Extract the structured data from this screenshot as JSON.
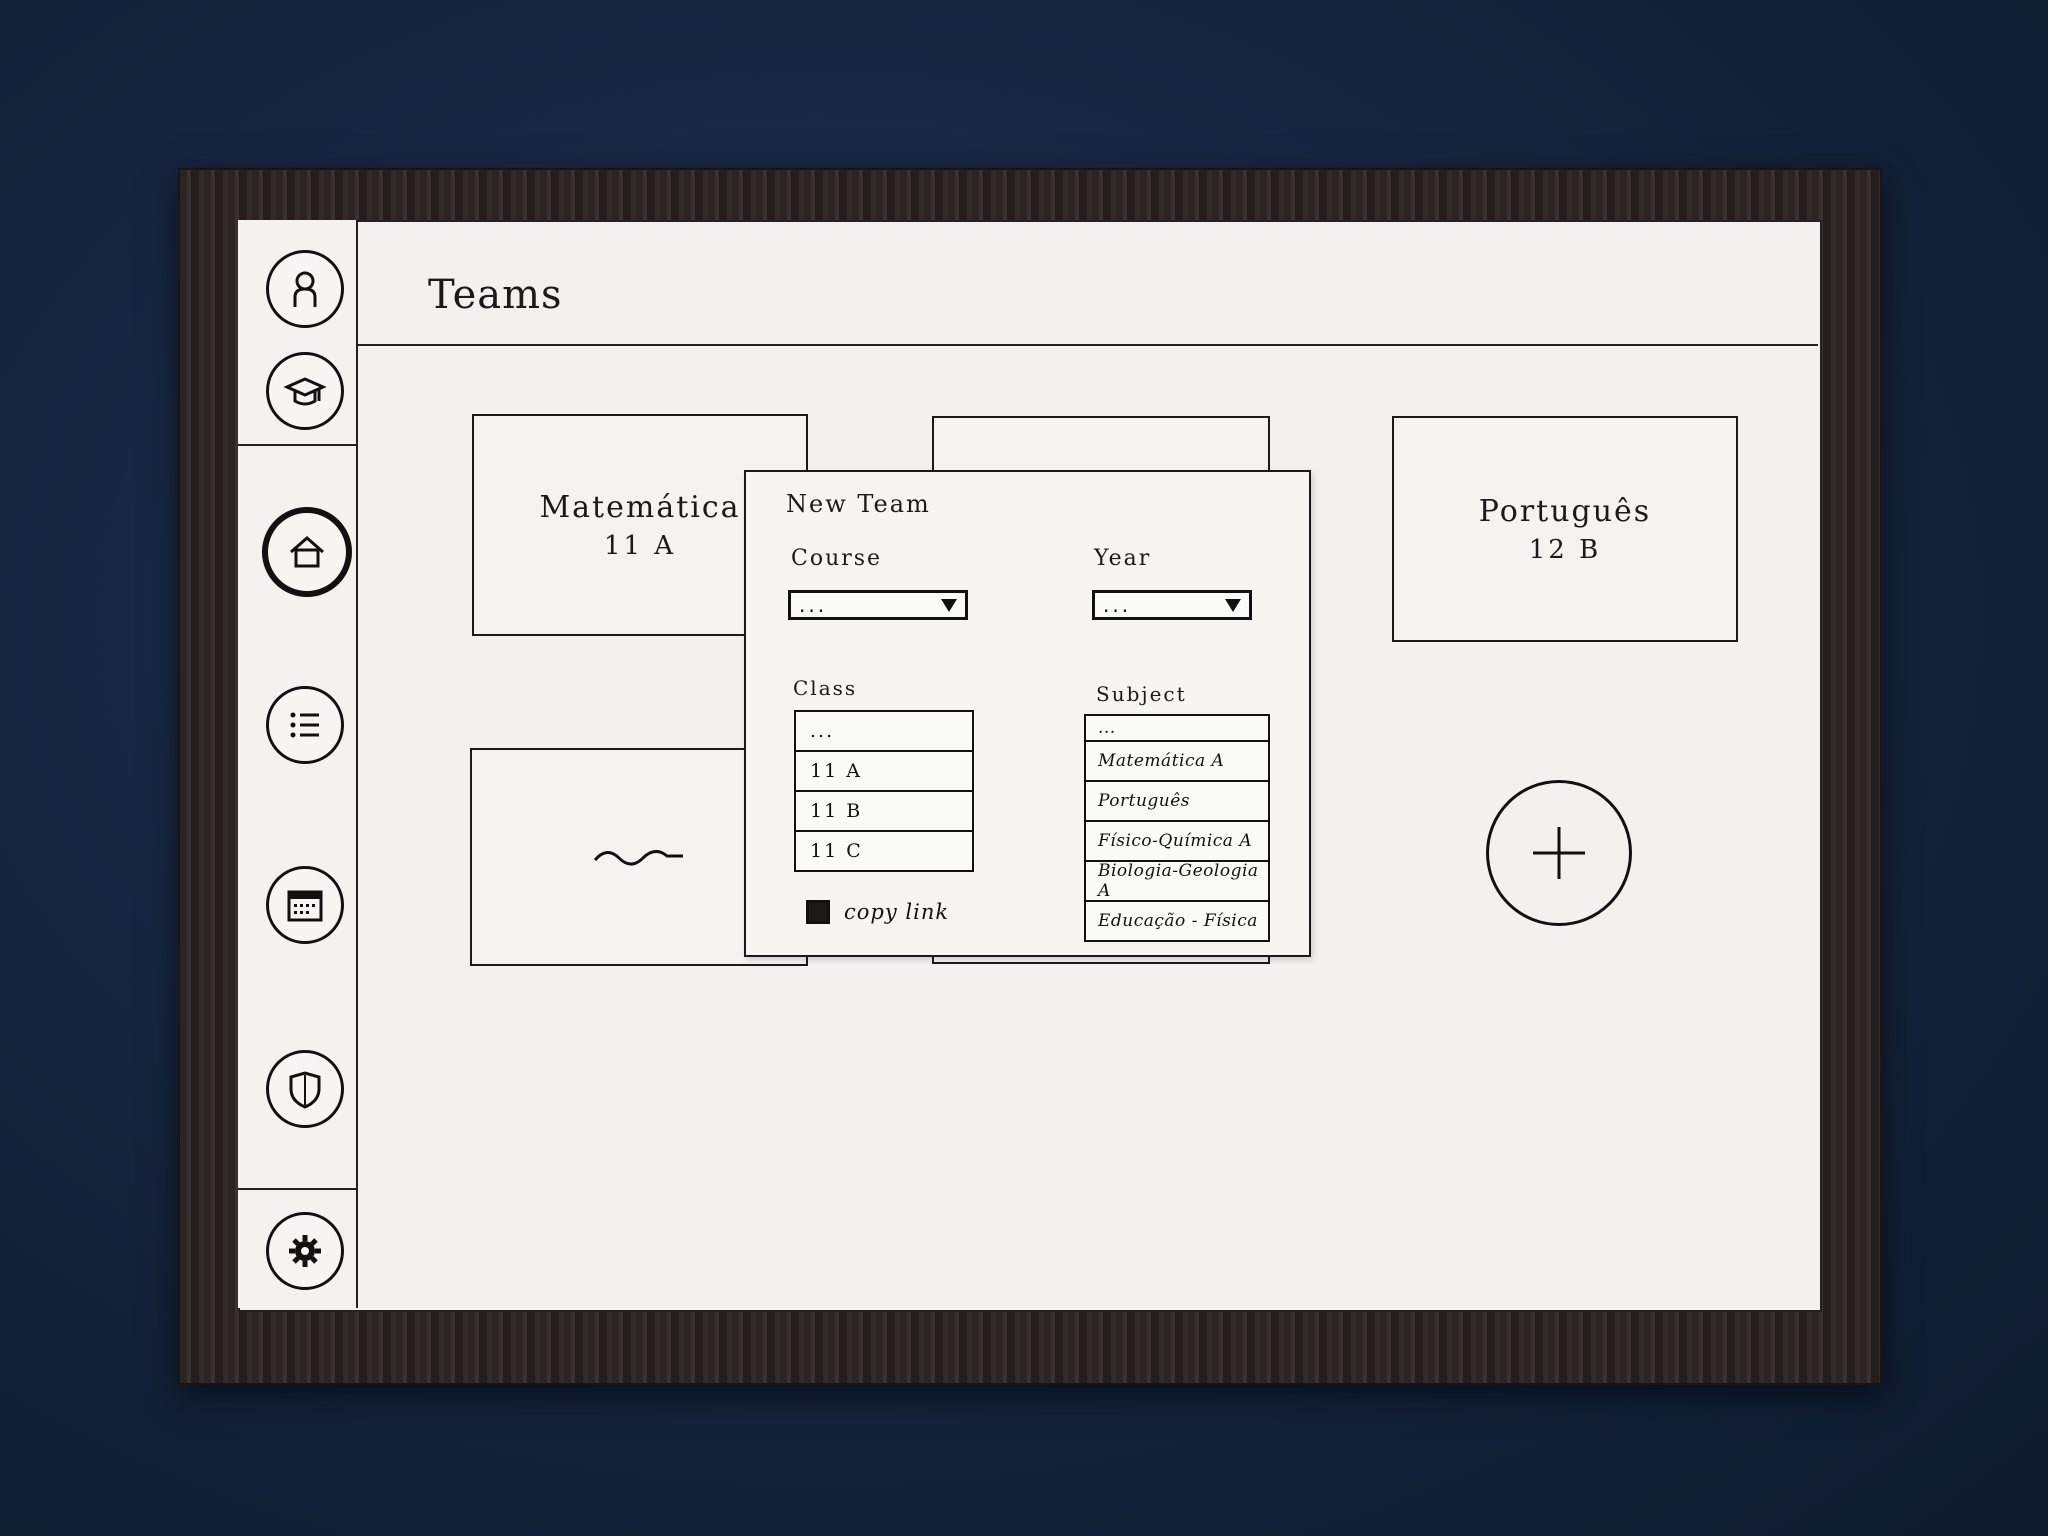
{
  "header": {
    "title": "Teams"
  },
  "sidebar": {
    "items": [
      {
        "name": "profile",
        "icon": "user-icon"
      },
      {
        "name": "courses",
        "icon": "graduation-cap-icon"
      },
      {
        "name": "home",
        "icon": "home-icon",
        "active": true
      },
      {
        "name": "list",
        "icon": "list-icon"
      },
      {
        "name": "calendar",
        "icon": "calendar-icon"
      },
      {
        "name": "security",
        "icon": "shield-icon"
      },
      {
        "name": "settings",
        "icon": "gear-icon"
      }
    ]
  },
  "teams": [
    {
      "name": "Matemática",
      "class": "11 A"
    },
    {
      "name": "",
      "class": ""
    },
    {
      "name": "Português",
      "class": "12 B"
    },
    {
      "name": "~",
      "class": ""
    },
    {
      "name": "",
      "class": ""
    }
  ],
  "add_button": {
    "icon": "plus-icon"
  },
  "modal": {
    "title": "New Team",
    "course": {
      "label": "Course",
      "value": "..."
    },
    "year": {
      "label": "Year",
      "value": "..."
    },
    "class": {
      "label": "Class",
      "options": [
        "...",
        "11 A",
        "11 B",
        "11 C"
      ]
    },
    "subject": {
      "label": "Subject",
      "options": [
        "...",
        "Matemática A",
        "Português",
        "Físico-Química A",
        "Biologia-Geologia A",
        "Educação - Física"
      ]
    },
    "copy_link": {
      "label": "copy link",
      "checked": true
    }
  }
}
